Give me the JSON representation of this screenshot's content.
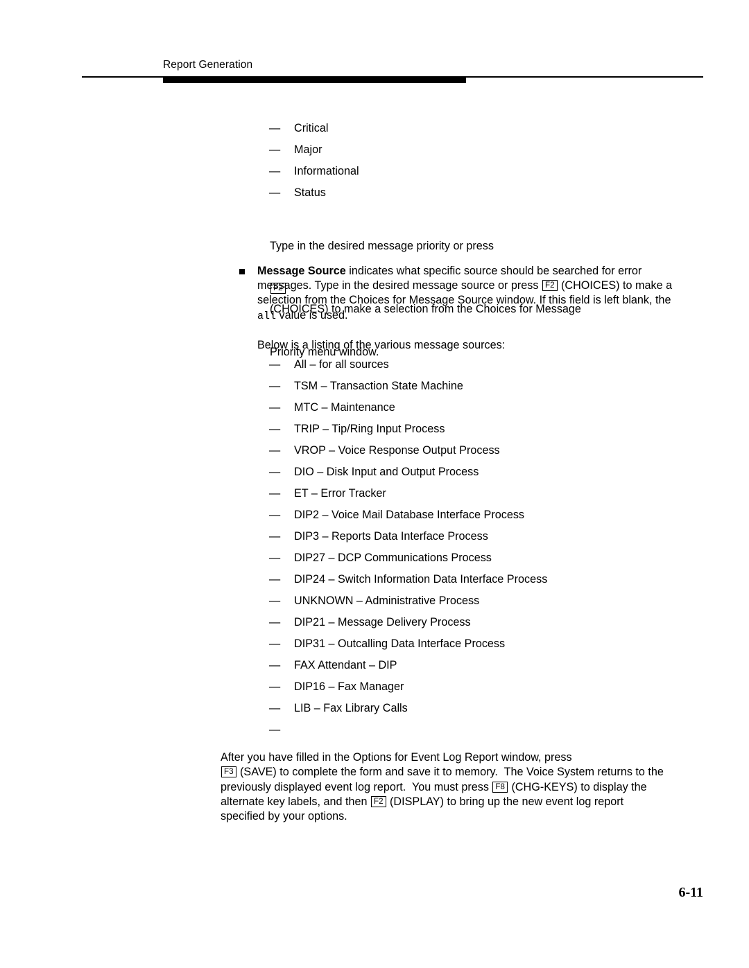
{
  "header": {
    "title": "Report Generation"
  },
  "priority_list": [
    {
      "dash": "—",
      "label": "Critical"
    },
    {
      "dash": "—",
      "label": "Major"
    },
    {
      "dash": "—",
      "label": "Informational"
    },
    {
      "dash": "—",
      "label": "Status"
    }
  ],
  "priority_paragraph": {
    "line1": "Type in the desired message priority or press",
    "key": "F2",
    "line2_after_key": "(CHOICES) to make a selection from the Choices for Message",
    "line3": "Priority menu window."
  },
  "message_source_bullet": {
    "bullet_glyph": "■",
    "bold_lead": "Message Source",
    "text_part1": " indicates what specific source should be searched for error messages.  Type in the desired message source or press ",
    "key": "F2",
    "text_part2": " (CHOICES) to make a selection from the Choices for Message Source window.  If this field is left blank, the ",
    "mono_value": "all",
    "text_part3": " value is used."
  },
  "sources_intro": "Below is a listing of the various message sources:",
  "sources_list": [
    {
      "dash": "—",
      "label": "All – for all sources"
    },
    {
      "dash": "—",
      "label": "TSM – Transaction State Machine"
    },
    {
      "dash": "—",
      "label": "MTC – Maintenance"
    },
    {
      "dash": "—",
      "label": "TRIP – Tip/Ring Input Process"
    },
    {
      "dash": "—",
      "label": "VROP – Voice Response Output Process"
    },
    {
      "dash": "—",
      "label": "DIO – Disk Input and Output Process"
    },
    {
      "dash": "—",
      "label": "ET – Error Tracker"
    },
    {
      "dash": "—",
      "label": "DIP2 – Voice Mail Database Interface Process"
    },
    {
      "dash": "—",
      "label": "DIP3 – Reports Data Interface Process"
    },
    {
      "dash": "—",
      "label": "DIP27 – DCP Communications Process"
    },
    {
      "dash": "—",
      "label": "DIP24 – Switch Information Data Interface Process"
    },
    {
      "dash": "—",
      "label": "UNKNOWN – Administrative Process"
    },
    {
      "dash": "—",
      "label": "DIP21 – Message Delivery Process"
    },
    {
      "dash": "—",
      "label": "DIP31 – Outcalling Data Interface Process"
    },
    {
      "dash": "—",
      "label": "FAX Attendant –  DIP"
    },
    {
      "dash": "—",
      "label": "DIP16 – Fax Manager"
    },
    {
      "dash": "—",
      "label": "LIB – Fax Library Calls"
    },
    {
      "dash": "—",
      "label": ""
    }
  ],
  "closing_paragraph": {
    "line1": "After you have filled in the Options for Event Log Report window, press",
    "key_save": "F3",
    "seg1": "(SAVE) to complete the form and save it to memory.  The Voice System returns to the previously displayed event log report.  You must press",
    "key_chgkeys": "F8",
    "seg2": "(CHG-KEYS) to display the alternate key labels, and then",
    "key_display": "F2",
    "seg3": "(DISPLAY) to bring up the new event log report specified by your options."
  },
  "page_number": "6-11"
}
